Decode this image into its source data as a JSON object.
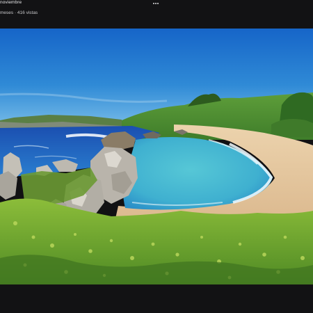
{
  "post": {
    "date_fragment": "noviembre",
    "meta": "meses · 416 vistas"
  },
  "icons": {
    "more": "more-horizontal-icon"
  },
  "colors": {
    "background": "#121214",
    "sky": "#1f7fd0",
    "sea_deep": "#1a5fb4",
    "lagoon": "#4ec3d4",
    "sand": "#e6c9a3",
    "grass": "#7fb03a"
  }
}
